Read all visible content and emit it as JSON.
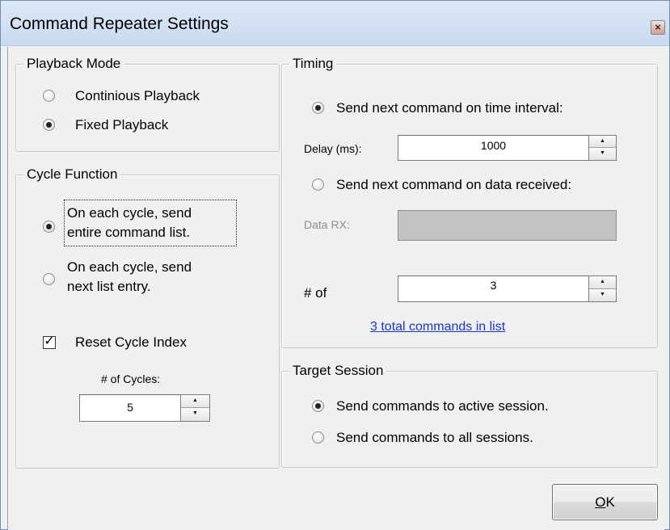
{
  "window": {
    "title": "Command Repeater Settings",
    "close_glyph": "×"
  },
  "playback_mode": {
    "title": "Playback Mode",
    "options": [
      {
        "label": "Continious Playback",
        "checked": false
      },
      {
        "label": "Fixed Playback",
        "checked": true
      }
    ]
  },
  "cycle_function": {
    "title": "Cycle Function",
    "options": [
      {
        "line1": "On each cycle, send",
        "line2": "entire command list.",
        "checked": true
      },
      {
        "line1": "On each cycle, send",
        "line2": "next list entry.",
        "checked": false
      }
    ],
    "reset_cycle_index": {
      "label": "Reset Cycle Index",
      "checked": true,
      "tick": "✓"
    },
    "num_cycles_label": "# of Cycles:",
    "num_cycles_value": "5"
  },
  "timing": {
    "title": "Timing",
    "option_interval": {
      "label": "Send next command on time interval:",
      "checked": true
    },
    "delay_label": "Delay (ms):",
    "delay_value": "1000",
    "option_data": {
      "label": "Send next command on data received:",
      "checked": false
    },
    "data_rx_label": "Data RX:",
    "num_label": "# of",
    "num_value": "3",
    "total_link": "3 total commands in list"
  },
  "target_session": {
    "title": "Target Session",
    "options": [
      {
        "label": "Send commands to active session.",
        "checked": true
      },
      {
        "label": "Send commands to all sessions.",
        "checked": false
      }
    ]
  },
  "buttons": {
    "ok_mnemonic": "O",
    "ok_rest": "K"
  },
  "spin": {
    "up_glyph": "▲",
    "down_glyph": "▼"
  }
}
